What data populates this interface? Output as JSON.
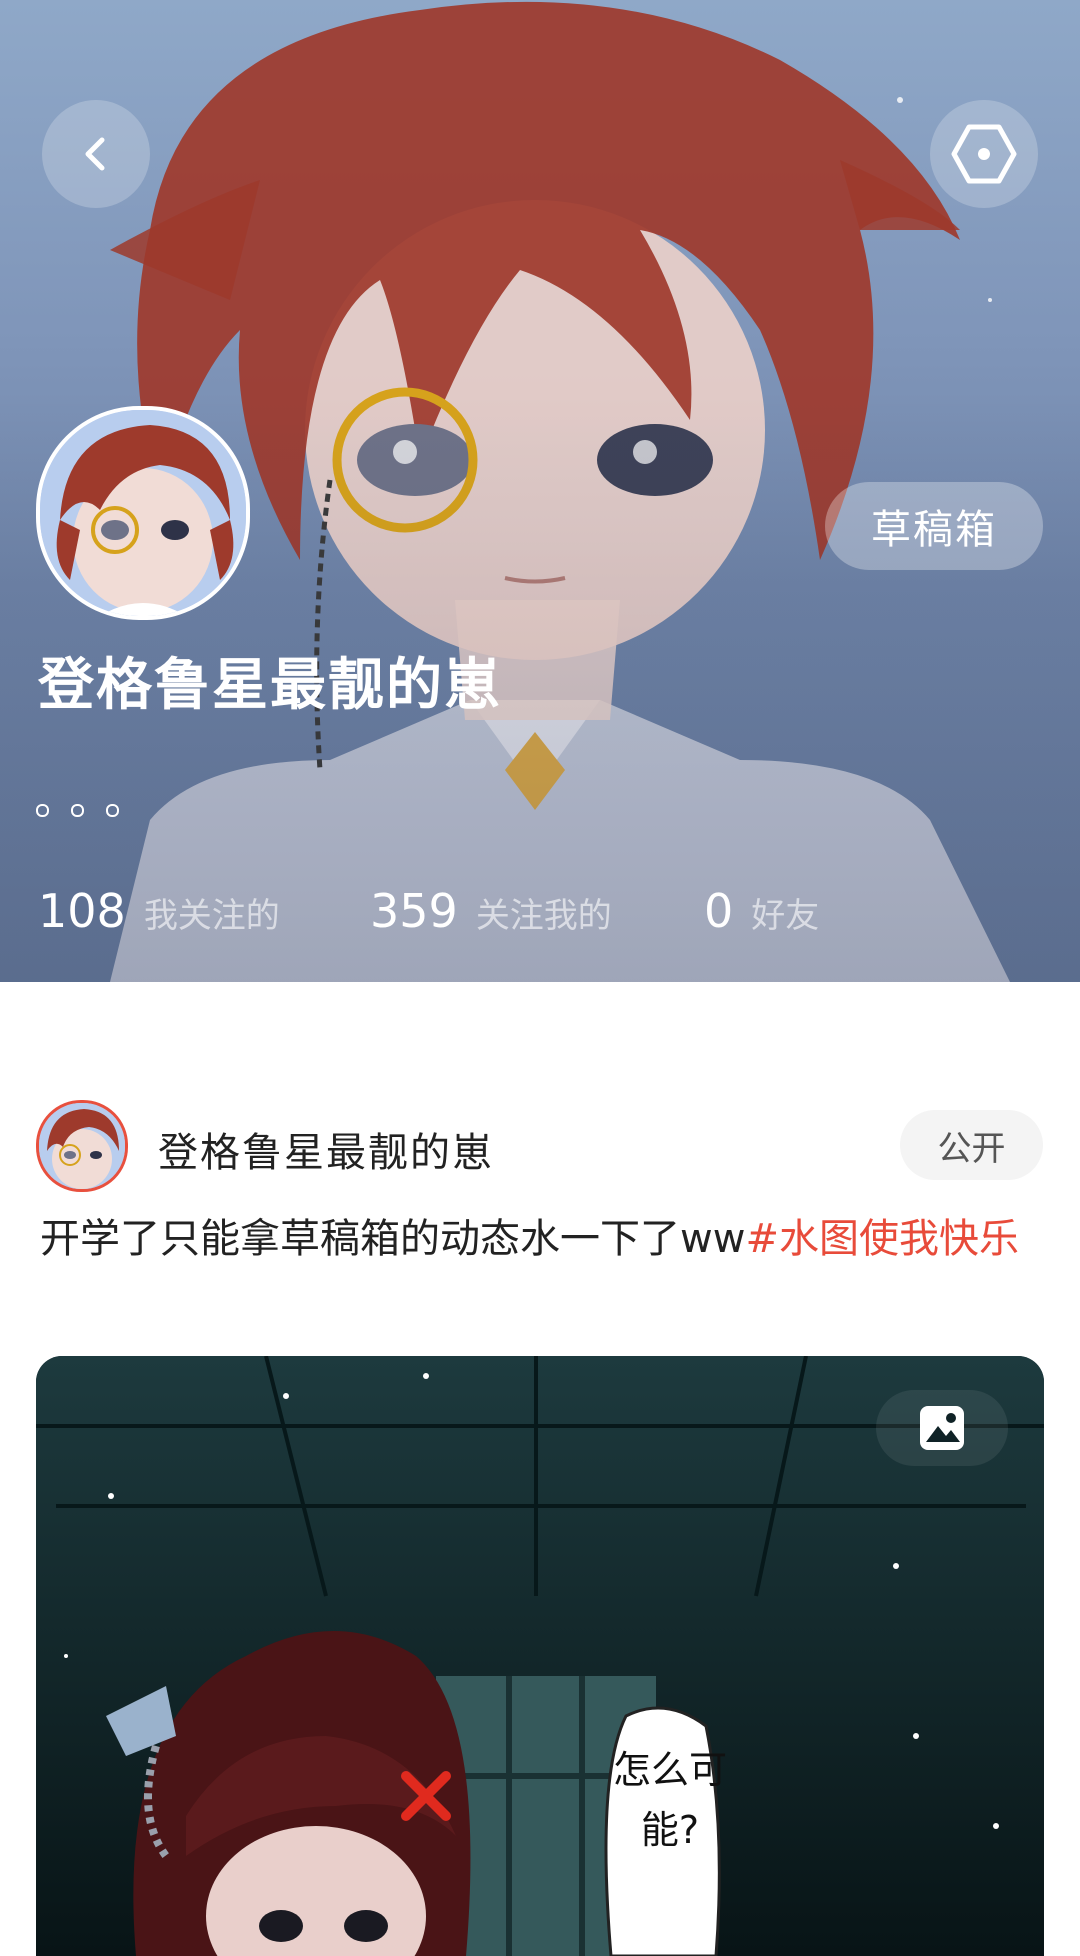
{
  "profile": {
    "name": "登格鲁星最靓的崽",
    "draft_button": "草稿箱",
    "stats": [
      {
        "num": "108",
        "label": "我关注的"
      },
      {
        "num": "359",
        "label": "关注我的"
      },
      {
        "num": "0",
        "label": "好友"
      }
    ]
  },
  "post": {
    "author": "登格鲁星最靓的崽",
    "visibility": "公开",
    "text": "开学了只能拿草稿箱的动态水一下了ww",
    "hashtag": "#水图使我快乐",
    "image_speech_bubble": "怎么可能?"
  },
  "icons": {
    "back": "chevron-left-icon",
    "settings": "hexagon-settings-icon",
    "image_type": "image-icon"
  },
  "colors": {
    "accent": "#e84b3a",
    "header_bg": "#7f95b9",
    "hair": "#9e3a2c"
  }
}
